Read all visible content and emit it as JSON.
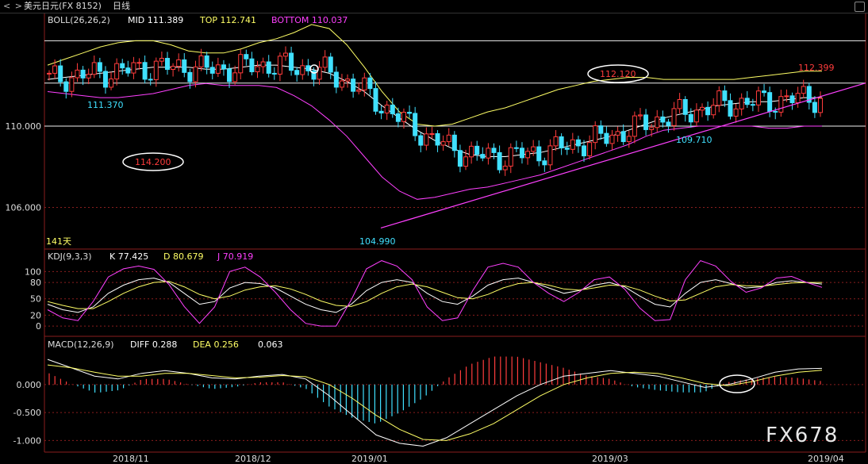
{
  "header": {
    "nav": "< >",
    "title": "美元日元(FX 8152)",
    "period": "日线"
  },
  "boll": {
    "label": "BOLL(26,26,2)",
    "mid": "MID 111.389",
    "top": "TOP 112.741",
    "bottom": "BOTTOM 110.037"
  },
  "kdj": {
    "label": "KDJ(9,3,3)",
    "k": "K 77.425",
    "d": "D 80.679",
    "j": "J 70.919"
  },
  "macd": {
    "label": "MACD(12,26,9)",
    "diff": "DIFF 0.288",
    "dea": "DEA 0.256",
    "macd": "0.063"
  },
  "watermark": "FX678",
  "days_label": "141天",
  "colors": {
    "up": "#ff3c3c",
    "down": "#40e0ff",
    "mid": "#ffffff",
    "top": "#ffff66",
    "bottom": "#ff40ff",
    "grid": "#8a1e1e"
  },
  "chart_data": [
    {
      "type": "candlestick",
      "title": "美元日元(FX 8152)",
      "x_ticks": [
        "2018/11",
        "2018/12",
        "2019/01",
        "2019/03",
        "2019/04"
      ],
      "y_ticks": [
        106.0,
        110.0
      ],
      "ylim": [
        104.5,
        114.8
      ],
      "horizontal_lines": [
        114.2,
        112.12,
        110.0
      ],
      "annotations": [
        {
          "text": "114.200",
          "value": 114.2,
          "circled": true
        },
        {
          "text": "111.370",
          "value": 111.37
        },
        {
          "text": "104.990",
          "value": 104.99
        },
        {
          "text": "112.120",
          "value": 112.12,
          "circled": true
        },
        {
          "text": "109.710",
          "value": 109.71
        },
        {
          "text": "112.399",
          "value": 112.399
        }
      ],
      "support_line": {
        "from": 104.99,
        "to": 112.2
      },
      "series": [
        {
          "name": "MID",
          "values": [
            112.3,
            112.4,
            112.5,
            112.6,
            112.7,
            112.8,
            112.9,
            112.9,
            112.9,
            112.8,
            112.8,
            112.9,
            113.0,
            113.0,
            112.9,
            112.8,
            112.6,
            112.2,
            111.7,
            111.0,
            110.4,
            109.8,
            109.3,
            108.9,
            108.6,
            108.5,
            108.5,
            108.6,
            108.7,
            108.9,
            109.1,
            109.3,
            109.5,
            109.8,
            110.1,
            110.4,
            110.6,
            110.8,
            111.0,
            111.1,
            111.2,
            111.2,
            111.3,
            111.4,
            111.4
          ]
        },
        {
          "name": "TOP",
          "values": [
            113.0,
            113.3,
            113.6,
            113.9,
            114.1,
            114.2,
            114.2,
            114.0,
            113.7,
            113.6,
            113.6,
            113.8,
            114.1,
            114.3,
            114.6,
            115.0,
            114.8,
            114.0,
            112.9,
            111.7,
            110.7,
            110.1,
            110.0,
            110.1,
            110.4,
            110.7,
            110.9,
            111.2,
            111.5,
            111.8,
            112.0,
            112.2,
            112.3,
            112.4,
            112.4,
            112.3,
            112.3,
            112.3,
            112.3,
            112.3,
            112.4,
            112.5,
            112.6,
            112.7,
            112.7
          ]
        },
        {
          "name": "BOTTOM",
          "values": [
            111.7,
            111.6,
            111.5,
            111.4,
            111.4,
            111.5,
            111.6,
            111.8,
            112.0,
            112.1,
            112.0,
            112.0,
            112.0,
            111.9,
            111.5,
            111.0,
            110.3,
            109.5,
            108.5,
            107.5,
            106.8,
            106.4,
            106.5,
            106.7,
            106.9,
            107.0,
            107.2,
            107.4,
            107.6,
            107.9,
            108.2,
            108.5,
            108.8,
            109.1,
            109.5,
            109.8,
            109.9,
            110.0,
            110.0,
            110.0,
            110.0,
            109.9,
            109.9,
            110.0,
            110.0
          ]
        }
      ]
    },
    {
      "type": "line",
      "title": "KDJ(9,3,3)",
      "y_ticks": [
        0,
        20,
        50,
        80,
        100
      ],
      "ylim": [
        -10,
        115
      ],
      "series": [
        {
          "name": "K",
          "values": [
            40,
            30,
            25,
            35,
            60,
            75,
            85,
            88,
            80,
            60,
            40,
            45,
            70,
            80,
            78,
            70,
            55,
            40,
            30,
            25,
            40,
            65,
            80,
            85,
            80,
            60,
            45,
            40,
            55,
            75,
            85,
            88,
            80,
            70,
            60,
            65,
            75,
            80,
            72,
            55,
            40,
            35,
            60,
            80,
            85,
            78,
            70,
            72,
            80,
            83,
            80,
            77
          ]
        },
        {
          "name": "D",
          "values": [
            45,
            38,
            32,
            32,
            45,
            60,
            72,
            80,
            82,
            72,
            58,
            50,
            55,
            66,
            72,
            74,
            68,
            58,
            46,
            38,
            36,
            45,
            60,
            72,
            77,
            72,
            62,
            52,
            50,
            58,
            70,
            78,
            80,
            75,
            68,
            66,
            70,
            75,
            74,
            66,
            55,
            46,
            48,
            60,
            72,
            76,
            74,
            73,
            76,
            79,
            80,
            80
          ]
        },
        {
          "name": "J",
          "values": [
            30,
            15,
            10,
            45,
            90,
            105,
            110,
            104,
            76,
            36,
            5,
            35,
            100,
            108,
            90,
            62,
            30,
            5,
            0,
            0,
            48,
            105,
            120,
            110,
            85,
            35,
            10,
            15,
            65,
            108,
            115,
            108,
            80,
            60,
            45,
            62,
            85,
            90,
            68,
            33,
            10,
            12,
            85,
            120,
            110,
            82,
            62,
            70,
            88,
            91,
            80,
            71
          ]
        }
      ]
    },
    {
      "type": "bar",
      "title": "MACD(12,26,9)",
      "y_ticks": [
        -1.0,
        -0.5,
        0.0
      ],
      "ylim": [
        -1.15,
        0.55
      ],
      "series": [
        {
          "name": "DIFF",
          "values": [
            0.45,
            0.3,
            0.15,
            0.1,
            0.2,
            0.25,
            0.2,
            0.12,
            0.1,
            0.15,
            0.18,
            0.1,
            -0.2,
            -0.55,
            -0.9,
            -1.05,
            -1.1,
            -0.95,
            -0.7,
            -0.45,
            -0.2,
            0.0,
            0.15,
            0.2,
            0.25,
            0.2,
            0.15,
            0.05,
            -0.05,
            0.0,
            0.1,
            0.22,
            0.28,
            0.29
          ]
        },
        {
          "name": "DEA",
          "values": [
            0.35,
            0.3,
            0.22,
            0.15,
            0.15,
            0.2,
            0.2,
            0.16,
            0.12,
            0.13,
            0.16,
            0.14,
            0.0,
            -0.25,
            -0.55,
            -0.8,
            -0.98,
            -1.0,
            -0.88,
            -0.7,
            -0.45,
            -0.2,
            0.0,
            0.12,
            0.2,
            0.22,
            0.2,
            0.12,
            0.02,
            -0.02,
            0.05,
            0.15,
            0.22,
            0.256
          ]
        },
        {
          "name": "MACD",
          "values": [
            0.2,
            0.0,
            -0.15,
            -0.1,
            0.1,
            0.1,
            0.0,
            -0.08,
            -0.04,
            0.04,
            0.04,
            -0.08,
            -0.4,
            -0.6,
            -0.7,
            -0.5,
            -0.24,
            0.1,
            0.36,
            0.5,
            0.5,
            0.4,
            0.3,
            0.16,
            0.1,
            -0.04,
            -0.1,
            -0.14,
            -0.14,
            0.04,
            0.1,
            0.14,
            0.12,
            0.063
          ]
        }
      ]
    }
  ]
}
